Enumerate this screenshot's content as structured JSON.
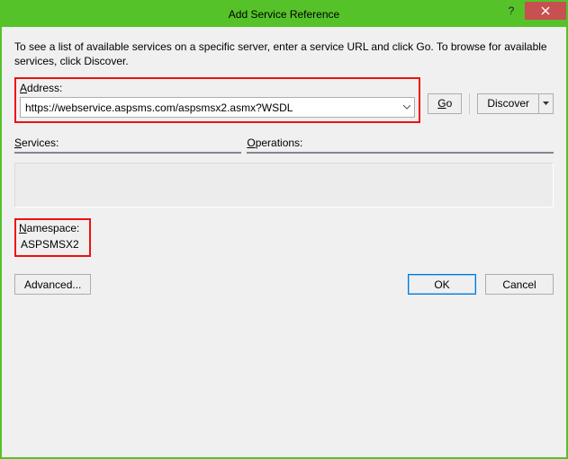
{
  "window": {
    "title": "Add Service Reference"
  },
  "description": "To see a list of available services on a specific server, enter a service URL and click Go. To browse for available services, click Discover.",
  "address": {
    "label": "Address:",
    "value": "https://webservice.aspsms.com/aspsmsx2.asmx?WSDL"
  },
  "buttons": {
    "go": "Go",
    "discover": "Discover",
    "advanced": "Advanced...",
    "ok": "OK",
    "cancel": "Cancel"
  },
  "panes": {
    "services": "Services:",
    "operations": "Operations:"
  },
  "namespace": {
    "label": "Namespace:",
    "value": "ASPSMSX2"
  }
}
